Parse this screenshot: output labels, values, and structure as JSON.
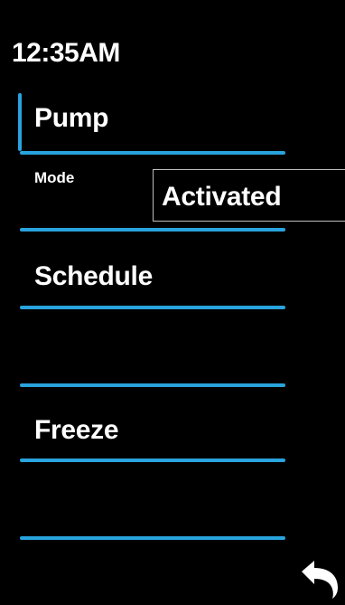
{
  "status": {
    "time": "12:35AM"
  },
  "menu": {
    "pump": {
      "title": "Pump",
      "mode_label": "Mode",
      "mode_value": "Activated"
    },
    "schedule": {
      "title": "Schedule"
    },
    "freeze": {
      "title": "Freeze"
    }
  },
  "colors": {
    "background": "#000000",
    "accent": "#29a3dd",
    "text": "#ffffff"
  },
  "icons": {
    "back": "back-arrow-icon"
  }
}
